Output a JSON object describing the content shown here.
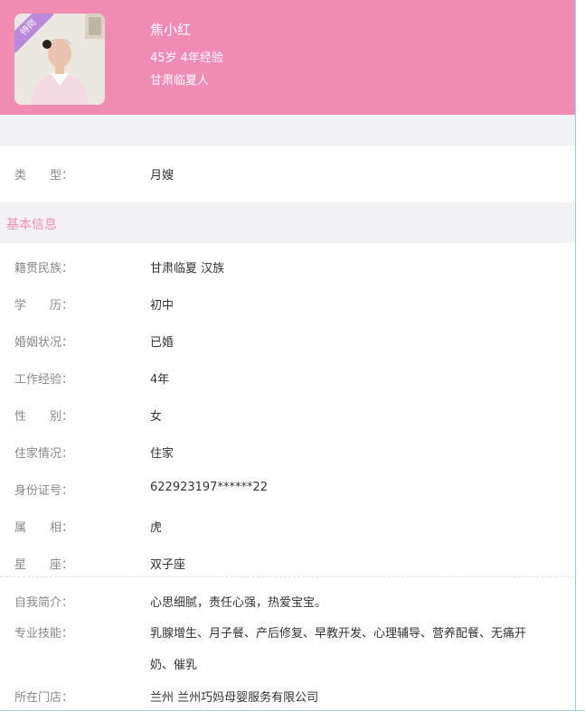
{
  "profile": {
    "badge": "待岗",
    "name": "焦小红",
    "meta": "45岁 4年经验",
    "origin": "甘肃临夏人"
  },
  "type_row": {
    "label": "类　　型：",
    "value": "月嫂"
  },
  "basic_section_title": "基本信息",
  "basic_rows": [
    {
      "label": "籍贯民族：",
      "value": "甘肃临夏 汉族"
    },
    {
      "label": "学　　历：",
      "value": "初中"
    },
    {
      "label": "婚姻状况：",
      "value": "已婚"
    },
    {
      "label": "工作经验：",
      "value": "4年"
    },
    {
      "label": "性　　别：",
      "value": "女"
    },
    {
      "label": "住家情况：",
      "value": "住家"
    },
    {
      "label": "身份证号：",
      "value": "622923197******22"
    },
    {
      "label": "属　　相：",
      "value": "虎"
    },
    {
      "label": "星　　座：",
      "value": "双子座"
    }
  ],
  "extra_rows": [
    {
      "label": "自我简介：",
      "value": "心思细腻，责任心强，热爱宝宝。"
    },
    {
      "label": "专业技能：",
      "value_line1": "乳腺增生、月子餐、产后修复、早教开发、心理辅导、营养配餐、无痛开",
      "value_line2": "奶、催乳"
    },
    {
      "label": "所在门店：",
      "value": "兰州 兰州巧妈母婴服务有限公司"
    }
  ],
  "colors": {
    "header_bg": "#f08cb2",
    "accent": "#f08cb2",
    "badge_bg": "#b98ad9"
  }
}
